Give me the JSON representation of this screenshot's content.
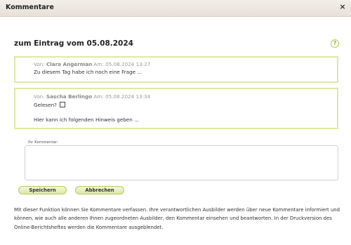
{
  "window": {
    "title": "Kommentare",
    "close_symbol": "×"
  },
  "heading": "zum Eintrag vom 05.08.2024",
  "help_symbol": "?",
  "comments": [
    {
      "prefix": "Von:",
      "author": "Clara Angerman",
      "date_label": "Am:",
      "date": "05.08.2024 13:27",
      "text": "Zu diesem Tag habe ich noch eine Frage ..."
    },
    {
      "prefix": "Von:",
      "author": "Sascha Berlingo",
      "date_label": "Am:",
      "date": "05.08.2024 13:34",
      "read_label": "Gelesen?",
      "read_checked": false,
      "text": "Hier kann ich folgenden Hinweis geben ..."
    }
  ],
  "form": {
    "label": "Ihr Kommentar:",
    "value": "",
    "save_label": "Speichern",
    "cancel_label": "Abbrechen"
  },
  "footer_text": "Mit dieser Funktion können Sie Kommentare verfassen. Ihre verantwortlichen Ausbilder werden über neue Kommentare informiert und können, wie auch alle anderen Ihnen zugeordneten Ausbilder, den Kommentar einsehen und beantworten. In der Druckversion des Online-Berichtsheftes werden die Kommentare ausgeblendet.",
  "colors": {
    "accent_border": "#dfe8a3",
    "button_bg": "#dbe7a2"
  }
}
